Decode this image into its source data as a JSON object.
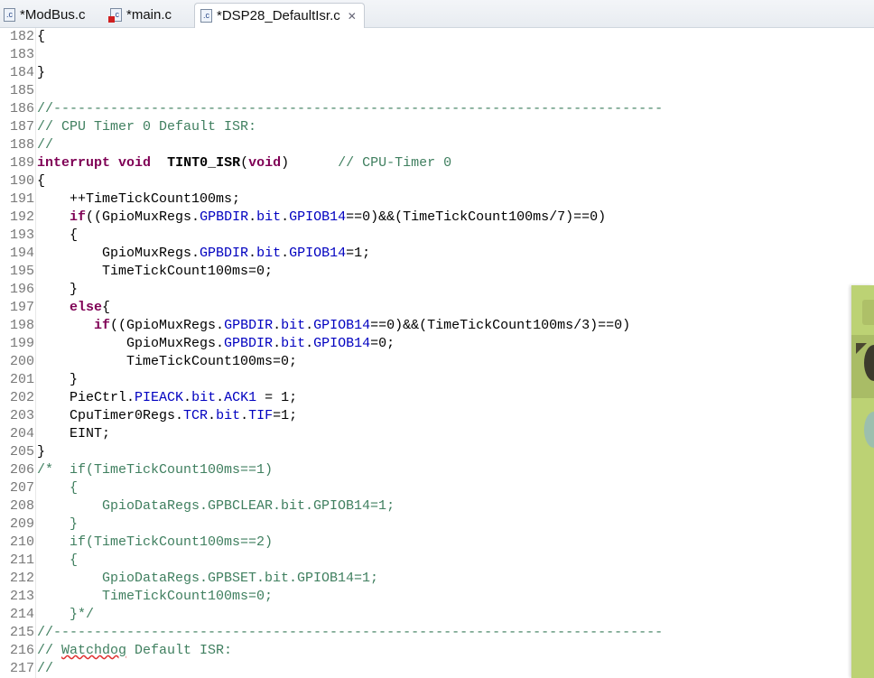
{
  "tabs": [
    {
      "label": "*ModBus.c",
      "icon": "c-file-icon",
      "error": false
    },
    {
      "label": "*main.c",
      "icon": "c-file-error-icon",
      "error": true
    },
    {
      "label": "*DSP28_DefaultIsr.c",
      "icon": "c-file-icon",
      "error": false,
      "active": true
    }
  ],
  "file_icon_text": ".c",
  "close_glyph": "✕",
  "lines": [
    {
      "n": "182",
      "t": [
        [
          "p",
          "{"
        ]
      ]
    },
    {
      "n": "183",
      "t": []
    },
    {
      "n": "184",
      "t": [
        [
          "p",
          "}"
        ]
      ]
    },
    {
      "n": "185",
      "t": []
    },
    {
      "n": "186",
      "t": [
        [
          "cm",
          "//---------------------------------------------------------------------------"
        ]
      ]
    },
    {
      "n": "187",
      "t": [
        [
          "cm",
          "// CPU Timer 0 Default ISR:"
        ]
      ]
    },
    {
      "n": "188",
      "t": [
        [
          "cm",
          "//"
        ]
      ]
    },
    {
      "n": "189",
      "t": [
        [
          "kw",
          "interrupt"
        ],
        [
          "p",
          " "
        ],
        [
          "kw",
          "void"
        ],
        [
          "p",
          "  "
        ],
        [
          "fn",
          "TINT0_ISR"
        ],
        [
          "p",
          "("
        ],
        [
          "kw",
          "void"
        ],
        [
          "p",
          ")      "
        ],
        [
          "cm",
          "// CPU-Timer 0"
        ]
      ]
    },
    {
      "n": "190",
      "t": [
        [
          "p",
          "{"
        ]
      ]
    },
    {
      "n": "191",
      "t": [
        [
          "p",
          "    ++TimeTickCount100ms;"
        ]
      ]
    },
    {
      "n": "192",
      "t": [
        [
          "p",
          "    "
        ],
        [
          "kw",
          "if"
        ],
        [
          "p",
          "((GpioMuxRegs."
        ],
        [
          "fld",
          "GPBDIR"
        ],
        [
          "p",
          "."
        ],
        [
          "fld",
          "bit"
        ],
        [
          "p",
          "."
        ],
        [
          "fld",
          "GPIOB14"
        ],
        [
          "p",
          "==0)&&(TimeTickCount100ms/7)==0)"
        ]
      ]
    },
    {
      "n": "193",
      "t": [
        [
          "p",
          "    {"
        ]
      ]
    },
    {
      "n": "194",
      "t": [
        [
          "p",
          "        GpioMuxRegs."
        ],
        [
          "fld",
          "GPBDIR"
        ],
        [
          "p",
          "."
        ],
        [
          "fld",
          "bit"
        ],
        [
          "p",
          "."
        ],
        [
          "fld",
          "GPIOB14"
        ],
        [
          "p",
          "=1;"
        ]
      ]
    },
    {
      "n": "195",
      "t": [
        [
          "p",
          "        TimeTickCount100ms=0;"
        ]
      ]
    },
    {
      "n": "196",
      "t": [
        [
          "p",
          "    }"
        ]
      ]
    },
    {
      "n": "197",
      "t": [
        [
          "p",
          "    "
        ],
        [
          "kw",
          "else"
        ],
        [
          "p",
          "{"
        ]
      ]
    },
    {
      "n": "198",
      "t": [
        [
          "p",
          "       "
        ],
        [
          "kw",
          "if"
        ],
        [
          "p",
          "((GpioMuxRegs."
        ],
        [
          "fld",
          "GPBDIR"
        ],
        [
          "p",
          "."
        ],
        [
          "fld",
          "bit"
        ],
        [
          "p",
          "."
        ],
        [
          "fld",
          "GPIOB14"
        ],
        [
          "p",
          "==0)&&(TimeTickCount100ms/3)==0)"
        ]
      ]
    },
    {
      "n": "199",
      "t": [
        [
          "p",
          "           GpioMuxRegs."
        ],
        [
          "fld",
          "GPBDIR"
        ],
        [
          "p",
          "."
        ],
        [
          "fld",
          "bit"
        ],
        [
          "p",
          "."
        ],
        [
          "fld",
          "GPIOB14"
        ],
        [
          "p",
          "=0;"
        ]
      ]
    },
    {
      "n": "200",
      "t": [
        [
          "p",
          "           TimeTickCount100ms=0;"
        ]
      ]
    },
    {
      "n": "201",
      "t": [
        [
          "p",
          "    }"
        ]
      ]
    },
    {
      "n": "202",
      "t": [
        [
          "p",
          "    PieCtrl."
        ],
        [
          "fld",
          "PIEACK"
        ],
        [
          "p",
          "."
        ],
        [
          "fld",
          "bit"
        ],
        [
          "p",
          "."
        ],
        [
          "fld",
          "ACK1"
        ],
        [
          "p",
          " = 1;"
        ]
      ]
    },
    {
      "n": "203",
      "t": [
        [
          "p",
          "    CpuTimer0Regs."
        ],
        [
          "fld",
          "TCR"
        ],
        [
          "p",
          "."
        ],
        [
          "fld",
          "bit"
        ],
        [
          "p",
          "."
        ],
        [
          "fld",
          "TIF"
        ],
        [
          "p",
          "=1;"
        ]
      ]
    },
    {
      "n": "204",
      "t": [
        [
          "p",
          "    EINT;"
        ]
      ]
    },
    {
      "n": "205",
      "t": [
        [
          "p",
          "}"
        ]
      ]
    },
    {
      "n": "206",
      "t": [
        [
          "cm",
          "/*  if(TimeTickCount100ms==1)"
        ]
      ]
    },
    {
      "n": "207",
      "t": [
        [
          "cm",
          "    {"
        ]
      ]
    },
    {
      "n": "208",
      "t": [
        [
          "cm",
          "        GpioDataRegs.GPBCLEAR.bit.GPIOB14=1;"
        ]
      ]
    },
    {
      "n": "209",
      "t": [
        [
          "cm",
          "    }"
        ]
      ]
    },
    {
      "n": "210",
      "t": [
        [
          "cm",
          "    if(TimeTickCount100ms==2)"
        ]
      ]
    },
    {
      "n": "211",
      "t": [
        [
          "cm",
          "    {"
        ]
      ]
    },
    {
      "n": "212",
      "t": [
        [
          "cm",
          "        GpioDataRegs.GPBSET.bit.GPIOB14=1;"
        ]
      ]
    },
    {
      "n": "213",
      "t": [
        [
          "cm",
          "        TimeTickCount100ms=0;"
        ]
      ]
    },
    {
      "n": "214",
      "t": [
        [
          "cm",
          "    }*/"
        ]
      ]
    },
    {
      "n": "215",
      "t": [
        [
          "cm",
          "//---------------------------------------------------------------------------"
        ]
      ]
    },
    {
      "n": "216",
      "t": [
        [
          "cm",
          "// "
        ],
        [
          "cm spell",
          "Watchdog"
        ],
        [
          "cm",
          " Default ISR:"
        ]
      ]
    },
    {
      "n": "217",
      "t": [
        [
          "cm",
          "//"
        ]
      ]
    }
  ]
}
